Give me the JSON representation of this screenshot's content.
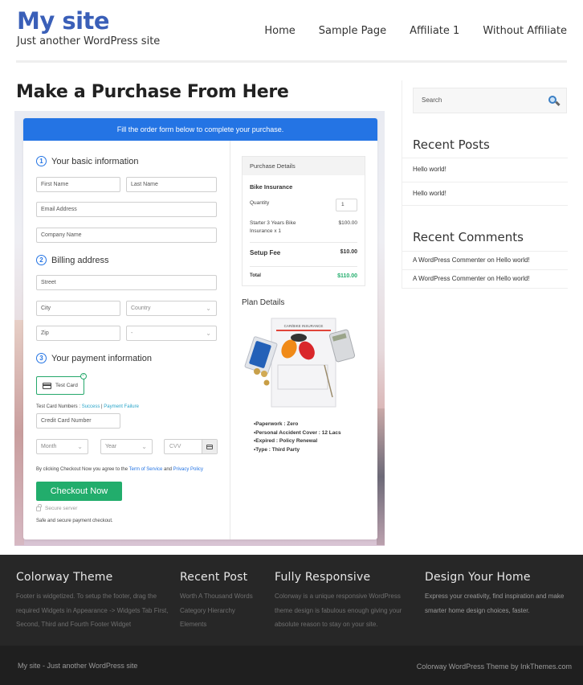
{
  "header": {
    "site_title": "My site",
    "tagline": "Just another WordPress site",
    "nav": [
      "Home",
      "Sample Page",
      "Affiliate 1",
      "Without Affiliate"
    ]
  },
  "page": {
    "title": "Make a Purchase From Here"
  },
  "form": {
    "banner": "Fill the order form below to complete your purchase.",
    "sections": [
      {
        "number": "1",
        "title": "Your basic information"
      },
      {
        "number": "2",
        "title": "Billing address"
      },
      {
        "number": "3",
        "title": "Your payment information"
      }
    ],
    "fields": {
      "first_name": "First Name",
      "last_name": "Last Name",
      "email": "Email Address",
      "company": "Company Name",
      "street": "Street",
      "city": "City",
      "country": "Country",
      "zip": "Zip",
      "state": "-",
      "card_number": "Credit Card Number",
      "month": "Month",
      "year": "Year",
      "cvv": "CVV"
    },
    "payment_option": "Test Card",
    "test_numbers_label": "Test Card Numbers : ",
    "test_success": "Success",
    "test_separator": " | ",
    "test_failure": "Payment Failure",
    "terms_prefix": "By clicking Checkout Now you agree to the ",
    "terms_link": "Term of Service",
    "terms_and": " and ",
    "privacy_link": "Privacy Policy",
    "checkout_button": "Checkout Now",
    "secure_server": "Secure server",
    "safe_note": "Safe and secure payment checkout."
  },
  "purchase": {
    "header": "Purchase Details",
    "product": "Bike Insurance",
    "quantity_label": "Quantity",
    "quantity": "1",
    "item_line1": "Starter 3 Years Bike",
    "item_line2": "Insurance x 1",
    "item_price": "$100.00",
    "setup_label": "Setup Fee",
    "setup_price": "$10.00",
    "total_label": "Total",
    "total_price": "$110.00",
    "total_color": "#22ad6c"
  },
  "plan": {
    "title": "Plan Details",
    "image_caption": "CAR/BIKE INSURANCE",
    "items": [
      "Paperwork : Zero",
      "Personal Accident Cover : 12 Lacs",
      "Expired : Policy Renewal",
      "Type : Third Party"
    ]
  },
  "sidebar": {
    "search_placeholder": "Search",
    "recent_posts_title": "Recent Posts",
    "recent_posts": [
      "Hello world!",
      "Hello world!"
    ],
    "recent_comments_title": "Recent Comments",
    "recent_comments": [
      "A WordPress Commenter on Hello world!",
      "A WordPress Commenter on Hello world!"
    ]
  },
  "footer": {
    "col1": {
      "title": "Colorway Theme",
      "text": "Footer is widgetized. To setup the footer, drag the required Widgets in Appearance -> Widgets Tab First, Second, Third and Fourth Footer Widget"
    },
    "col2": {
      "title": "Recent Post",
      "links": [
        "Worth A Thousand Words",
        "Category Hierarchy",
        "Elements"
      ]
    },
    "col3": {
      "title": "Fully Responsive",
      "text": "Colorway is a unique responsive WordPress theme design is fabulous enough giving your absolute reason to stay on your site."
    },
    "col4": {
      "title": "Design Your Home",
      "text": "Express your creativity, find inspiration and make smarter home design choices, faster."
    },
    "bottom_left": "My site - Just another WordPress site",
    "bottom_right": "Colorway WordPress Theme by InkThemes.com"
  },
  "colors": {
    "brand": "#3a5fb8",
    "banner": "#2474e4",
    "checkout": "#22ad6c",
    "footer_bg": "#272727"
  }
}
